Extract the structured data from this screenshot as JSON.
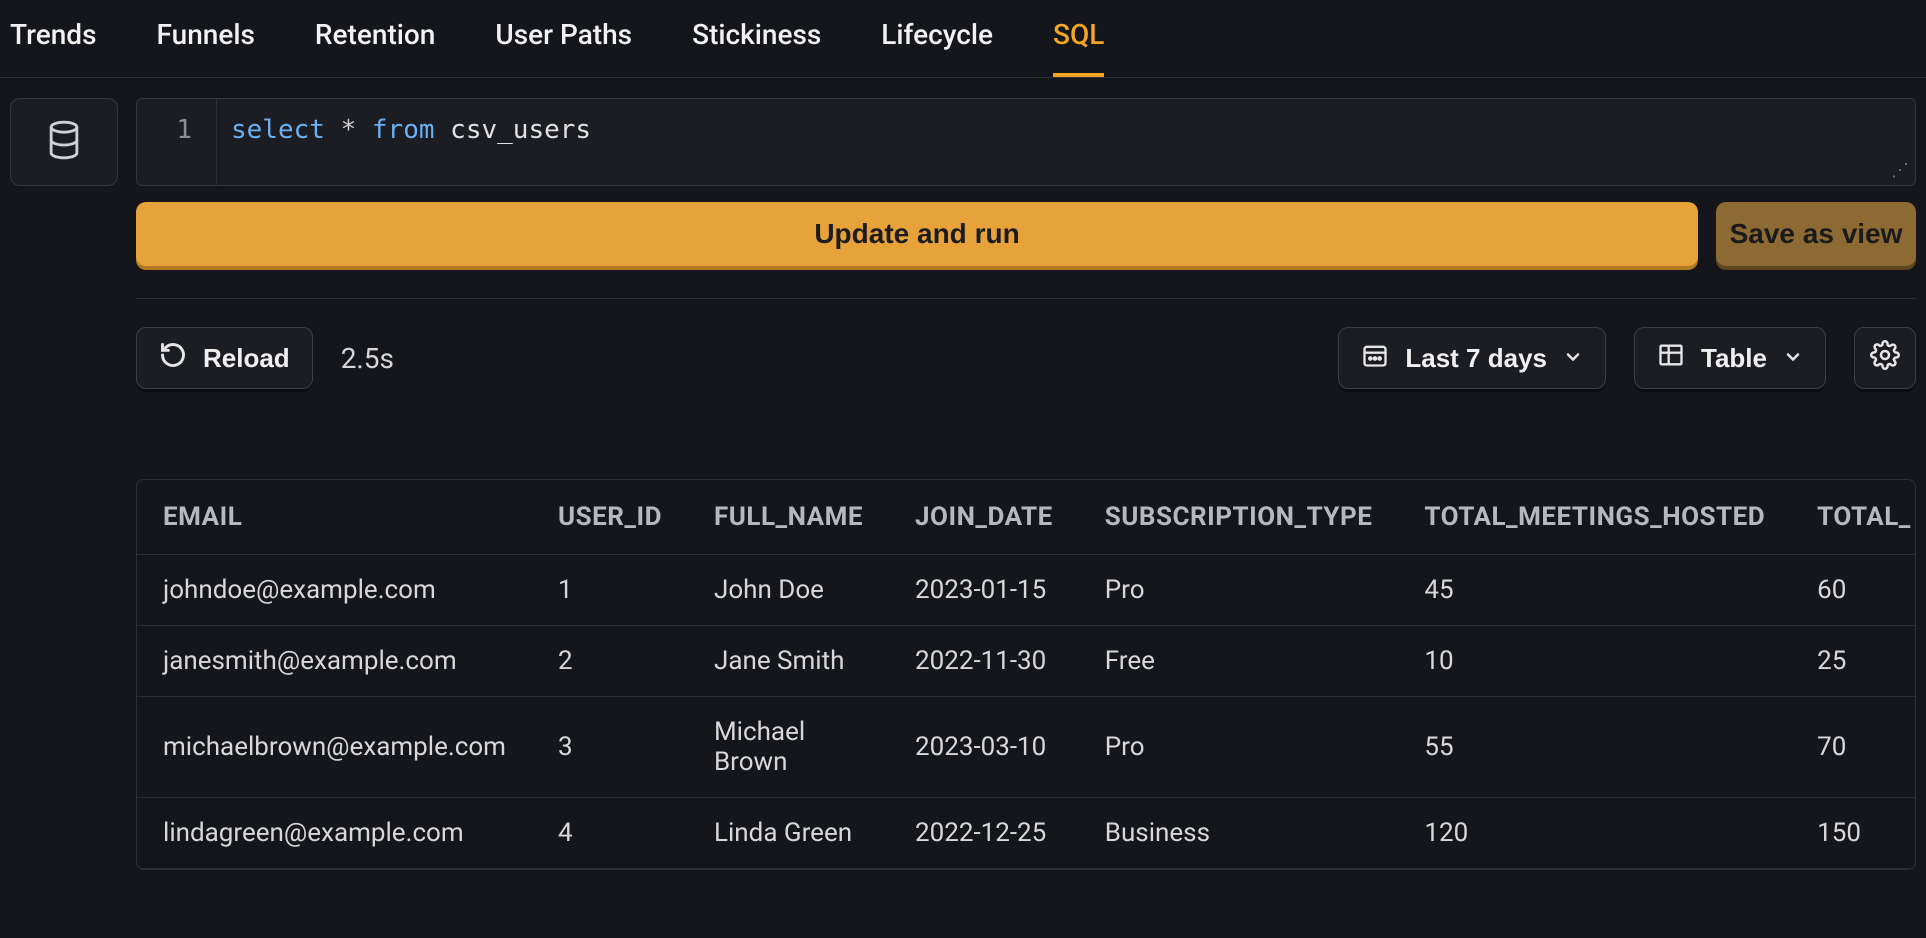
{
  "tabs": [
    "Trends",
    "Funnels",
    "Retention",
    "User Paths",
    "Stickiness",
    "Lifecycle",
    "SQL"
  ],
  "active_tab": "SQL",
  "editor": {
    "line_number": "1",
    "kw_select": "select",
    "star": "*",
    "kw_from": "from",
    "table_name": "csv_users"
  },
  "buttons": {
    "run": "Update and run",
    "save": "Save as view",
    "reload": "Reload"
  },
  "duration": "2.5s",
  "date_range": "Last 7 days",
  "view_mode": "Table",
  "table": {
    "headers": [
      "EMAIL",
      "USER_ID",
      "FULL_NAME",
      "JOIN_DATE",
      "SUBSCRIPTION_TYPE",
      "TOTAL_MEETINGS_HOSTED",
      "TOTAL_"
    ],
    "rows": [
      {
        "email": "johndoe@example.com",
        "user_id": "1",
        "full_name": "John Doe",
        "join_date": "2023-01-15",
        "subscription_type": "Pro",
        "total_meetings_hosted": "45",
        "total": "60"
      },
      {
        "email": "janesmith@example.com",
        "user_id": "2",
        "full_name": "Jane Smith",
        "join_date": "2022-11-30",
        "subscription_type": "Free",
        "total_meetings_hosted": "10",
        "total": "25"
      },
      {
        "email": "michaelbrown@example.com",
        "user_id": "3",
        "full_name": "Michael Brown",
        "join_date": "2023-03-10",
        "subscription_type": "Pro",
        "total_meetings_hosted": "55",
        "total": "70"
      },
      {
        "email": "lindagreen@example.com",
        "user_id": "4",
        "full_name": "Linda Green",
        "join_date": "2022-12-25",
        "subscription_type": "Business",
        "total_meetings_hosted": "120",
        "total": "150"
      }
    ]
  }
}
